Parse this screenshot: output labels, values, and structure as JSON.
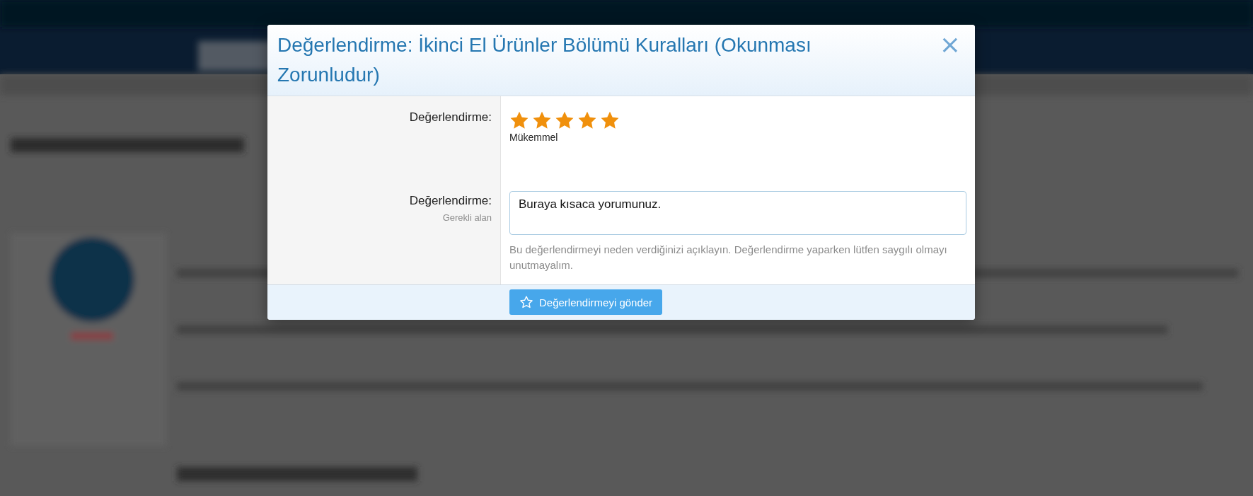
{
  "dialog": {
    "title": "Değerlendirme: İkinci El Ürünler Bölümü Kuralları (Okunması Zorunludur)",
    "close": "×",
    "rating": {
      "label": "Değerlendirme:",
      "stars": 5,
      "caption": "Mükemmel"
    },
    "review": {
      "label": "Değerlendirme:",
      "hint": "Gerekli alan",
      "value": "Buraya kısaca yorumunuz.",
      "explain": "Bu değerlendirmeyi neden verdiğinizi açıklayın. Değerlendirme yaparken lütfen saygılı olmayı unutmayalım."
    },
    "submit": "Değerlendirmeyi gönder"
  }
}
